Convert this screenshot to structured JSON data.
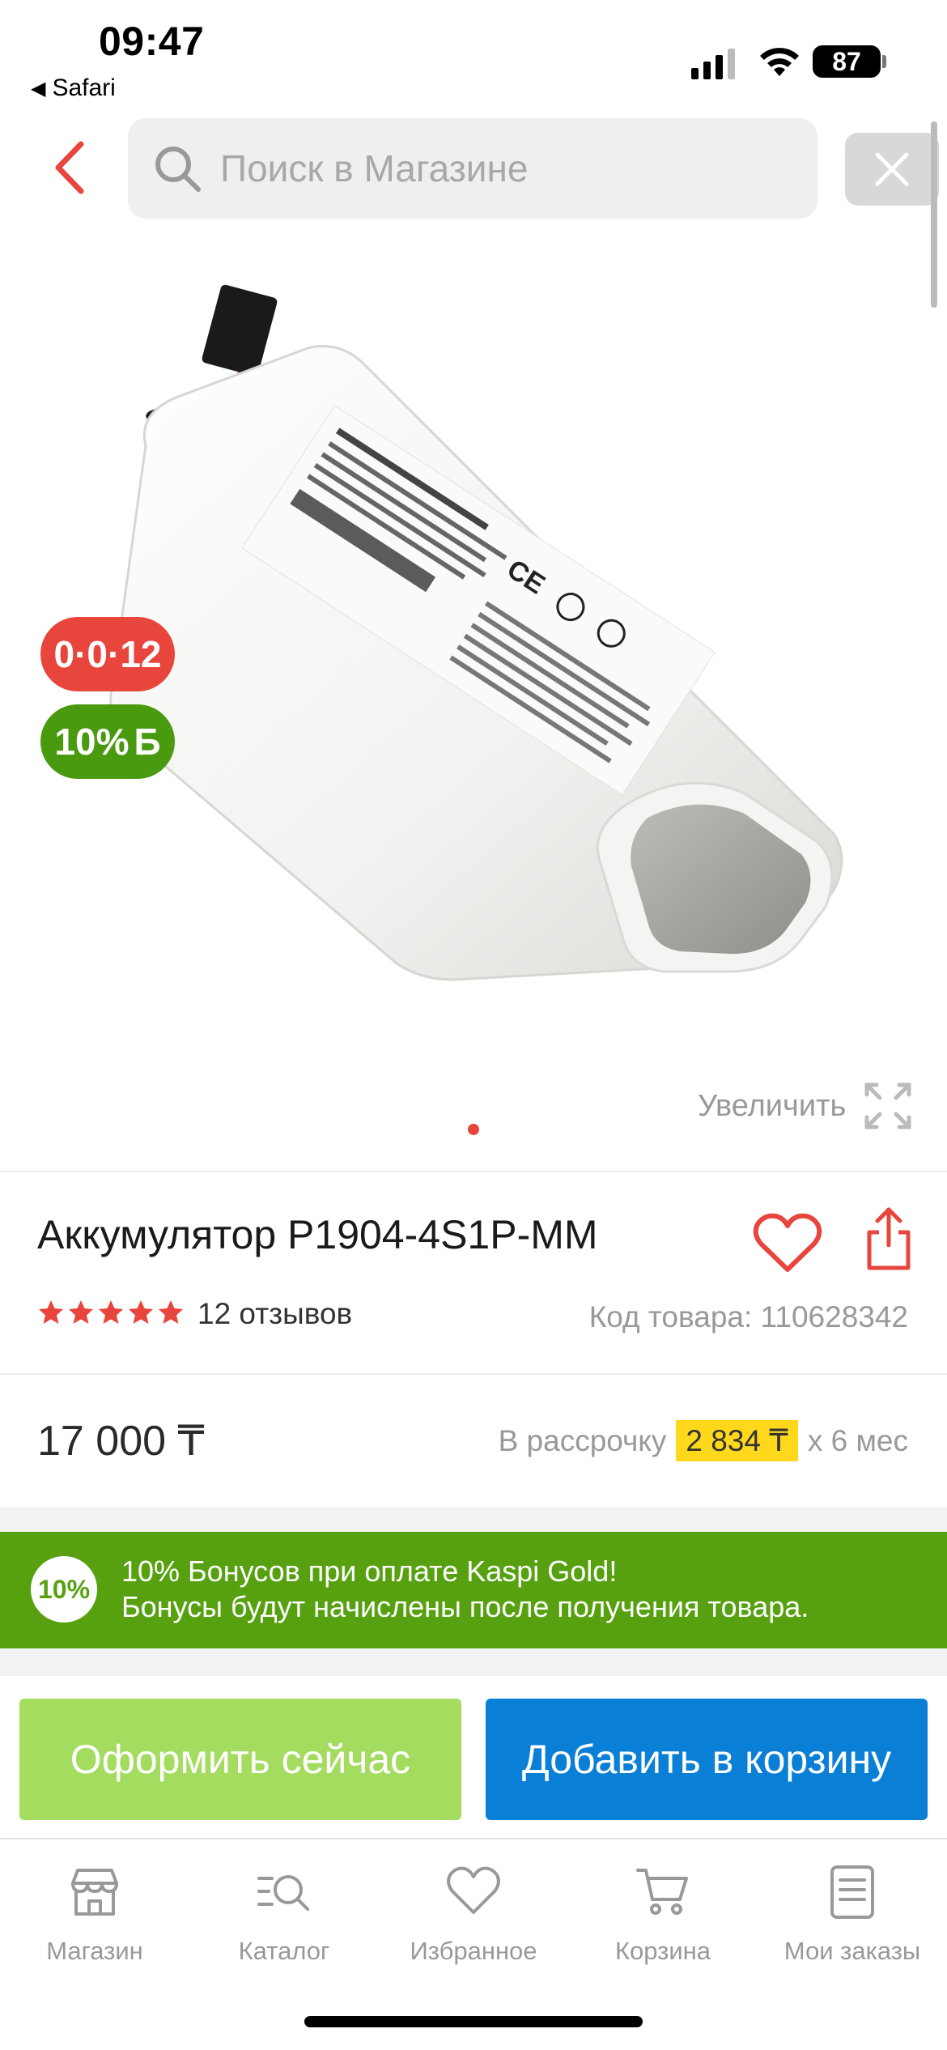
{
  "status_bar": {
    "time": "09:47",
    "back_app": "Safari",
    "battery": "87"
  },
  "search": {
    "placeholder": "Поиск в Магазине"
  },
  "badges": {
    "installment": "0·0·12",
    "bonus": "10%"
  },
  "gallery": {
    "zoom_label": "Увеличить"
  },
  "product": {
    "title": "Аккумулятор P1904-4S1P-MM",
    "rating": 5,
    "reviews": "12 отзывов",
    "code": "Код товара: 110628342",
    "price": "17 000 ₸"
  },
  "installment": {
    "prefix": "В рассрочку",
    "amount": "2 834 ₸",
    "suffix": "х 6 мес"
  },
  "promo": {
    "circle": "10%",
    "line1": "10% Бонусов при оплате Kaspi Gold!",
    "line2": "Бонусы будут начислены после получения товара."
  },
  "actions": {
    "buy_now": "Оформить сейчас",
    "add_to_cart": "Добавить в корзину"
  },
  "tabs": [
    {
      "label": "Магазин",
      "icon": "shop-icon"
    },
    {
      "label": "Каталог",
      "icon": "catalog-search-icon"
    },
    {
      "label": "Избранное",
      "icon": "heart-icon"
    },
    {
      "label": "Корзина",
      "icon": "cart-icon"
    },
    {
      "label": "Мои заказы",
      "icon": "orders-icon"
    }
  ],
  "colors": {
    "accent_red": "#e8453c",
    "bonus_green": "#57a110",
    "buy_now_green": "#a3dc5f",
    "cart_blue": "#0a7fd6",
    "installment_yellow": "#ffd81c"
  }
}
